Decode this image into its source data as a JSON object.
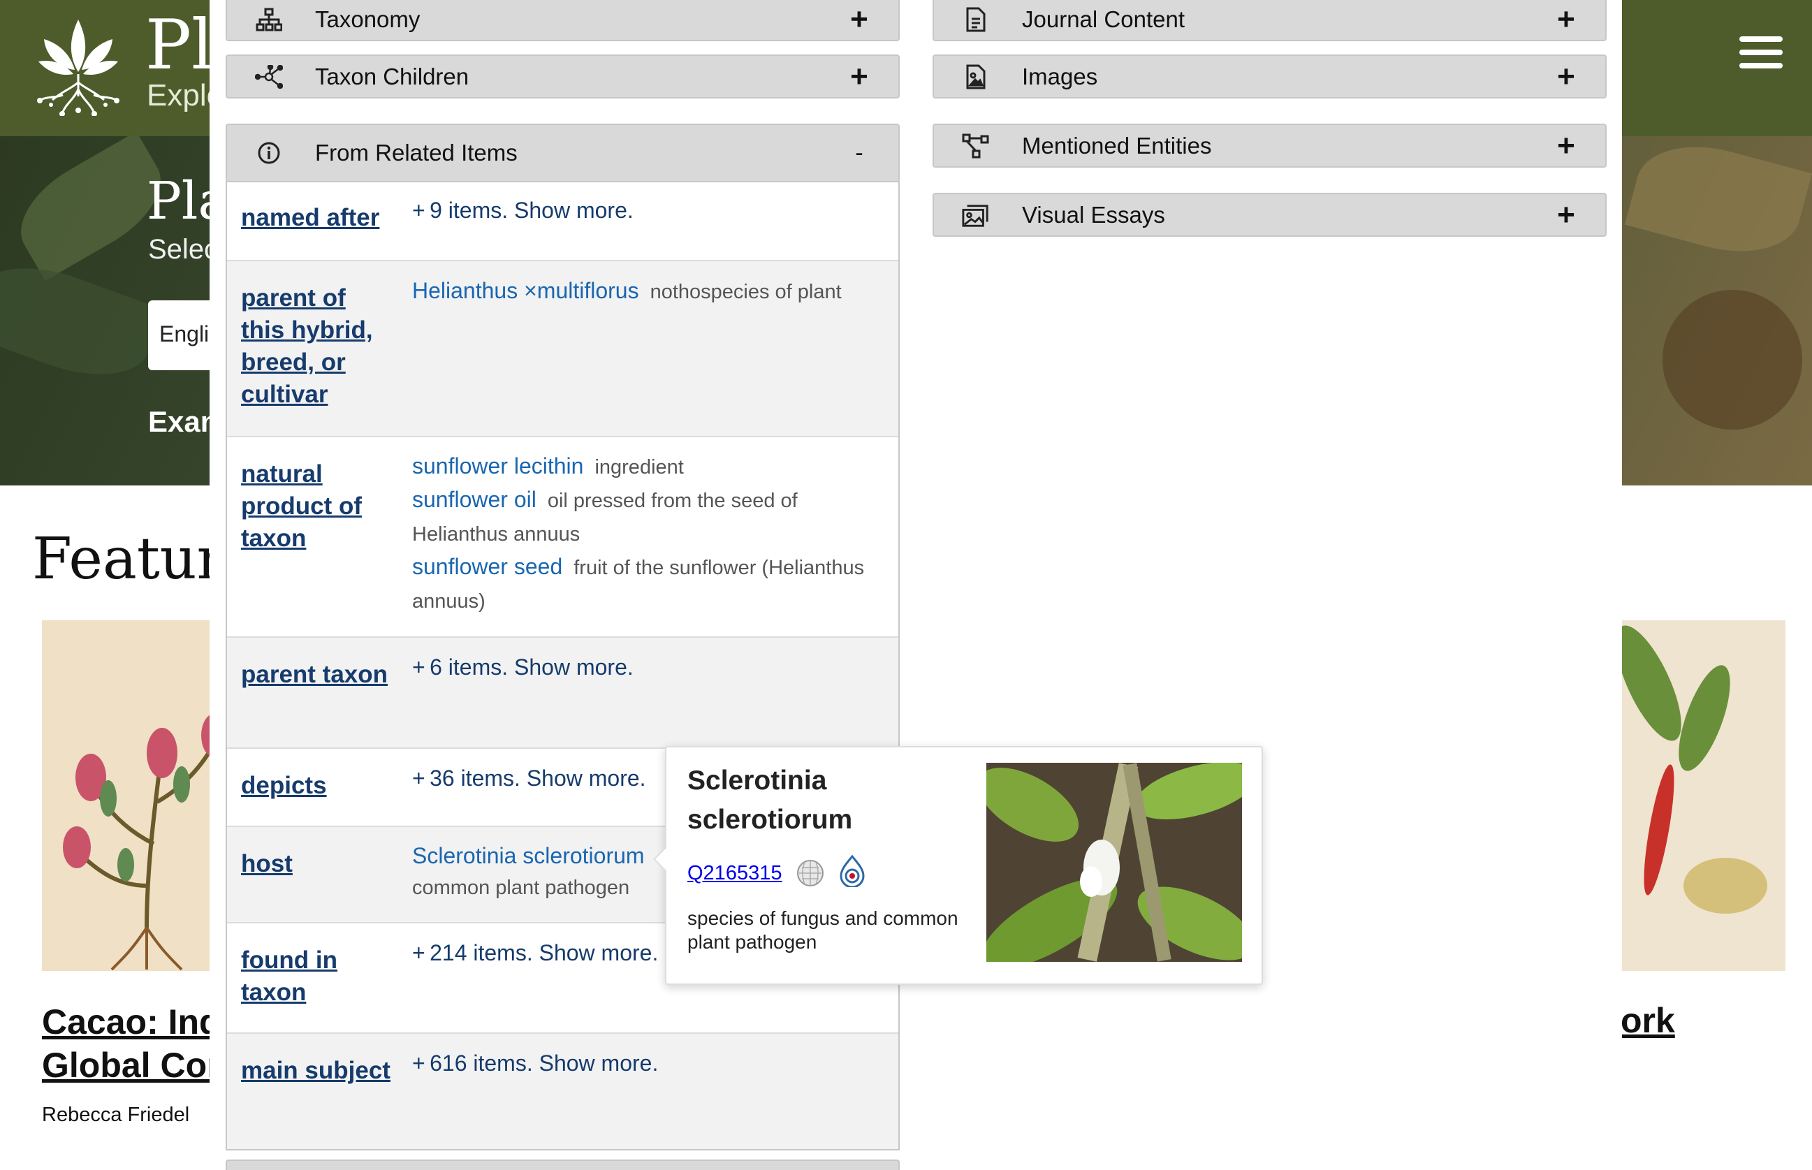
{
  "site": {
    "title": "Pl",
    "subtitle": "Explo",
    "hero_title": "Pla",
    "hero_sub": "Selec",
    "language_value": "Engli",
    "hero_example": "Exan",
    "featured_title": "Feature",
    "card_left_title": "Cacao: Indi Global Com",
    "card_left_author": "Rebecca Friedel",
    "card_right_title": "ork"
  },
  "left_sections": [
    {
      "label": "Taxonomy",
      "icon": "taxonomy-tree-icon",
      "toggle": "+"
    },
    {
      "label": "Taxon Children",
      "icon": "network-nodes-icon",
      "toggle": "+"
    },
    {
      "label": "From Related Items",
      "icon": "info-circle-icon",
      "toggle": "-"
    }
  ],
  "right_sections": [
    {
      "label": "Journal Content",
      "icon": "document-icon",
      "toggle": "+"
    },
    {
      "label": "Images",
      "icon": "image-file-icon",
      "toggle": "+"
    },
    {
      "label": "Mentioned Entities",
      "icon": "entity-graph-icon",
      "toggle": "+"
    },
    {
      "label": "Visual Essays",
      "icon": "gallery-icon",
      "toggle": "+"
    }
  ],
  "related": [
    {
      "property": "named after",
      "more": "+ 9 items. Show more."
    },
    {
      "property": "parent of this hybrid, breed, or cultivar",
      "entries": [
        {
          "label": "Helianthus ×multiflorus",
          "desc": "nothospecies of plant"
        }
      ]
    },
    {
      "property": "natural product of taxon",
      "entries": [
        {
          "label": "sunflower lecithin",
          "desc": "ingredient"
        },
        {
          "label": "sunflower oil",
          "desc": "oil pressed from the seed of Helianthus annuus"
        },
        {
          "label": "sunflower seed",
          "desc": "fruit of the sunflower (Helianthus annuus)"
        }
      ]
    },
    {
      "property": "parent taxon",
      "more": "+ 6 items. Show more."
    },
    {
      "property": "depicts",
      "more": "+ 36 items. Show more."
    },
    {
      "property": "host",
      "entries": [
        {
          "label": "Sclerotinia sclerotiorum",
          "desc": "common plant pathogen"
        }
      ]
    },
    {
      "property": "found in taxon",
      "more": "+ 214 items. Show more."
    },
    {
      "property": "main subject",
      "more": "+ 616 items. Show more."
    }
  ],
  "hover_card": {
    "title": "Sclerotinia sclerotiorum",
    "qid": "Q2165315",
    "description": "species of fungus and common plant pathogen"
  },
  "colors": {
    "header_bg": "#4d5c2a",
    "section_bg": "#d9d9d9",
    "property_link": "#163b6c",
    "entity_link": "#1a66b0"
  }
}
